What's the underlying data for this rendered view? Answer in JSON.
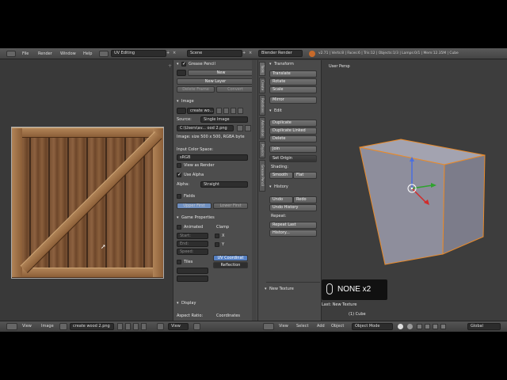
{
  "topbar": {
    "menus": [
      "File",
      "Render",
      "Window",
      "Help"
    ],
    "layout": "UV Editing",
    "scene": "Scene",
    "engine": "Blender Render",
    "stats": "v2.71 | Verts:8 | Faces:6 | Tris:12 | Objects:1/3 | Lamps:0/1 | Mem:12.35M | Cube"
  },
  "uv_editor": {
    "footer_view": "View",
    "footer_image": "Image",
    "footer_image_name": "create wood 2.png",
    "footer_view2": "View"
  },
  "properties": {
    "grease_pencil": "Grease Pencil",
    "new": "New",
    "new_layer": "New Layer",
    "delete_frame": "Delete Frame",
    "convert": "Convert",
    "image_panel": "Image",
    "image_name": "create wo...",
    "source_label": "Source:",
    "source_value": "Single Image",
    "filepath": "C:\\Users\\av... ood 2.png",
    "image_info": "Image: size 500 x 500, RGBA byte",
    "input_color_space": "Input Color Space:",
    "color_space": "sRGB",
    "view_as_render": "View as Render",
    "use_alpha": "Use Alpha",
    "alpha_label": "Alpha:",
    "alpha_value": "Straight",
    "fields": "Fields",
    "upper_first": "Upper First",
    "lower_first": "Lower First",
    "game_props": "Game Properties",
    "animated": "Animated",
    "clamp": "Clamp",
    "start": "Start:",
    "end": "End:",
    "speed": "Speed:",
    "x": "X",
    "y": "Y",
    "tiles": "Tiles",
    "uv_coordinates": "UV Coordinat",
    "reflection": "Reflection",
    "display": "Display",
    "aspect_ratio": "Aspect Ratio:",
    "coordinates": "Coordinates"
  },
  "tools": {
    "tabs": [
      "Tools",
      "Create",
      "Relations",
      "Animation",
      "Physics",
      "Grease Pencil"
    ],
    "transform": "Transform",
    "translate": "Translate",
    "rotate": "Rotate",
    "scale": "Scale",
    "mirror": "Mirror",
    "edit": "Edit",
    "duplicate": "Duplicate",
    "duplicate_linked": "Duplicate Linked",
    "delete": "Delete",
    "join": "Join",
    "set_origin": "Set Origin",
    "shading": "Shading:",
    "smooth": "Smooth",
    "flat": "Flat",
    "history": "History",
    "undo": "Undo",
    "redo": "Redo",
    "undo_history": "Undo History",
    "repeat": "Repeat:",
    "repeat_last": "Repeat Last",
    "history_btn": "History...",
    "new_texture": "New Texture"
  },
  "viewport": {
    "label": "User Persp",
    "object": "(1) Cube",
    "last_op": "Last: New Texture",
    "key_hint": "NONE x2",
    "footer_view": "View",
    "footer_select": "Select",
    "footer_add": "Add",
    "footer_object": "Object",
    "mode": "Object Mode",
    "orientation": "Global"
  }
}
